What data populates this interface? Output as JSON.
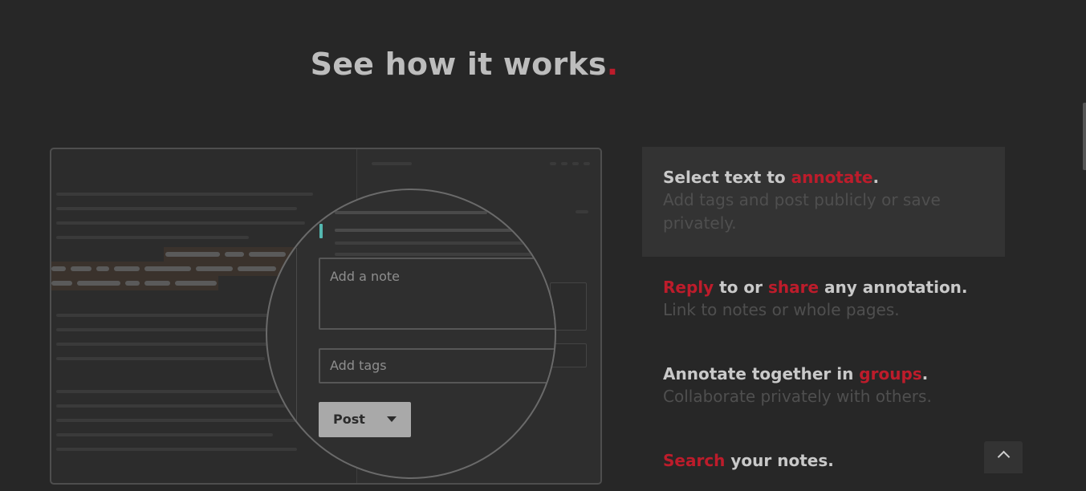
{
  "heading": {
    "text": "See how it works",
    "dot": "."
  },
  "mockup": {
    "note_placeholder": "Add a note",
    "tags_placeholder": "Add tags",
    "post_label": "Post"
  },
  "features": [
    {
      "pre": "Select text to ",
      "accent": "annotate",
      "post": ".",
      "desc": "Add tags and post publicly or save privately."
    },
    {
      "accent1": "Reply",
      "mid": " to or ",
      "accent2": "share",
      "post": " any annotation.",
      "desc": "Link to notes or whole pages."
    },
    {
      "pre": "Annotate together in ",
      "accent": "groups",
      "post": ".",
      "desc": "Collaborate privately with others."
    },
    {
      "accent": "Search",
      "post": " your notes."
    }
  ],
  "colors": {
    "accent": "#bd1c2b",
    "teal": "#54b7b0",
    "bg": "#272727"
  },
  "icons": {
    "scroll_top": "chevron-up-icon",
    "post_caret": "caret-down-icon"
  }
}
